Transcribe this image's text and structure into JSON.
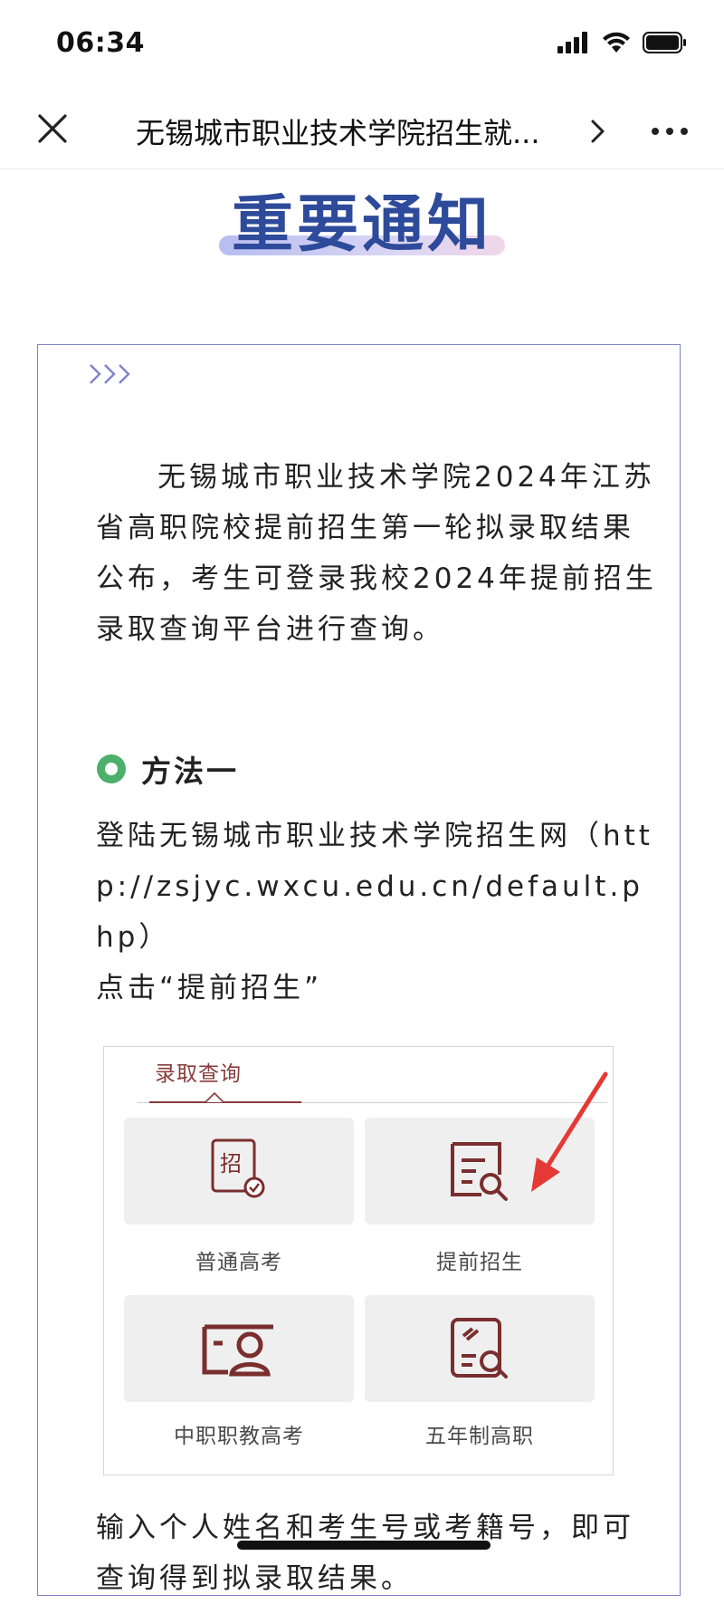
{
  "status_bar": {
    "time": "06:34"
  },
  "nav": {
    "title": "无锡城市职业技术学院招生就..."
  },
  "heading": {
    "text": "重要通知"
  },
  "article": {
    "paragraph1": "无锡城市职业技术学院2024年江苏省高职院校提前招生第一轮拟录取结果公布，考生可登录我校2024年提前招生录取查询平台进行查询。",
    "method1_title": "方法一",
    "paragraph2_line1": "登陆无锡城市职业技术学院招生网（http://zsjyc.wxcu.edu.cn/default.php）",
    "paragraph2_line2": "点击“提前招生”",
    "paragraph3": "输入个人姓名和考生号或考籍号，即可查询得到拟录取结果。"
  },
  "embedded_screenshot": {
    "tab_label": "录取查询",
    "tiles": [
      {
        "label": "普通高考",
        "icon": "admission-certificate-icon"
      },
      {
        "label": "提前招生",
        "icon": "document-search-icon"
      },
      {
        "label": "中职职教高考",
        "icon": "id-card-person-icon"
      },
      {
        "label": "五年制高职",
        "icon": "certificate-search-icon"
      }
    ]
  },
  "colors": {
    "heading": "#2e4a9a",
    "card_border": "#7f82cc",
    "method_dot": "#4caf6a",
    "embed_accent": "#8a3b3b",
    "arrow": "#e53935"
  }
}
